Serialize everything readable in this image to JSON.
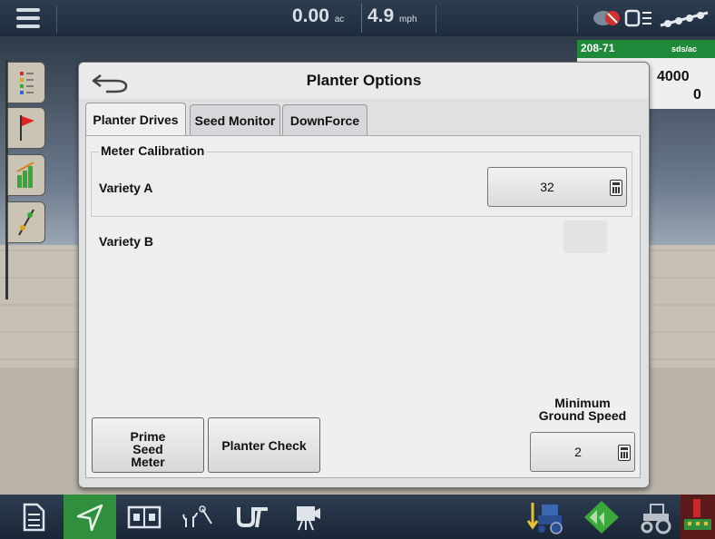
{
  "topbar": {
    "acres_value": "0.00",
    "acres_unit": "ac",
    "speed_value": "4.9",
    "speed_unit": "mph"
  },
  "right_panel": {
    "variety_code": "208-71",
    "rate_unit": "sds/ac",
    "rate_1": "4000",
    "rate_2": "0"
  },
  "dialog": {
    "title": "Planter Options",
    "tabs": [
      {
        "label": "Planter Drives",
        "active": true
      },
      {
        "label": "Seed Monitor",
        "active": false
      },
      {
        "label": "DownForce",
        "active": false
      }
    ],
    "meter_calibration": {
      "title": "Meter Calibration",
      "variety_a_label": "Variety A",
      "variety_a_value": "32",
      "variety_b_label": "Variety B"
    },
    "prime_seed_meter_lines": [
      "Prime",
      "Seed",
      "Meter"
    ],
    "planter_check_label": "Planter Check",
    "minimum_ground_speed_lines": [
      "Minimum",
      "Ground Speed"
    ],
    "minimum_ground_speed_value": "2"
  },
  "colors": {
    "topbar": "#1e2c3d",
    "accent_green": "#2f8f3c",
    "dialog_bg": "#dfe0e2"
  }
}
